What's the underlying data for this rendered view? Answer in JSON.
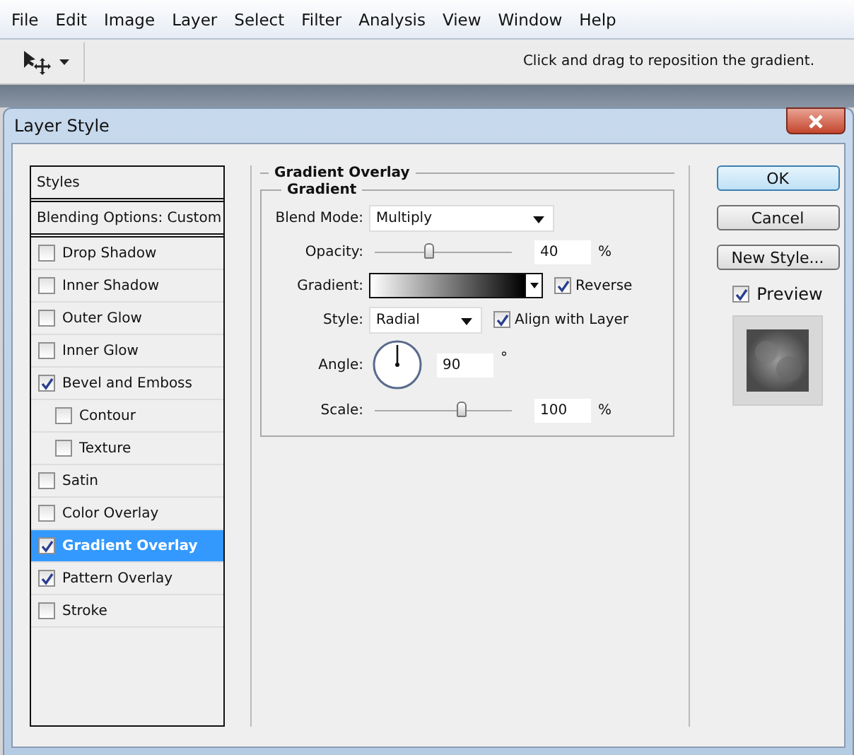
{
  "menu": [
    "File",
    "Edit",
    "Image",
    "Layer",
    "Select",
    "Filter",
    "Analysis",
    "View",
    "Window",
    "Help"
  ],
  "toolbar": {
    "hint": "Click and drag to reposition the gradient."
  },
  "dialog": {
    "title": "Layer Style",
    "styles": [
      {
        "kind": "header",
        "label": "Styles",
        "selected": false
      },
      {
        "kind": "header",
        "label": "Blending Options: Custom",
        "selected": false
      },
      {
        "kind": "check",
        "label": "Drop Shadow",
        "checked": false,
        "selected": false
      },
      {
        "kind": "check",
        "label": "Inner Shadow",
        "checked": false,
        "selected": false
      },
      {
        "kind": "check",
        "label": "Outer Glow",
        "checked": false,
        "selected": false
      },
      {
        "kind": "check",
        "label": "Inner Glow",
        "checked": false,
        "selected": false
      },
      {
        "kind": "check",
        "label": "Bevel and Emboss",
        "checked": true,
        "selected": false,
        "children": [
          {
            "kind": "check",
            "label": "Contour",
            "checked": false,
            "selected": false
          },
          {
            "kind": "check",
            "label": "Texture",
            "checked": false,
            "selected": false
          }
        ]
      },
      {
        "kind": "check",
        "label": "Satin",
        "checked": false,
        "selected": false
      },
      {
        "kind": "check",
        "label": "Color Overlay",
        "checked": false,
        "selected": false
      },
      {
        "kind": "check",
        "label": "Gradient Overlay",
        "checked": true,
        "selected": true
      },
      {
        "kind": "check",
        "label": "Pattern Overlay",
        "checked": true,
        "selected": false
      },
      {
        "kind": "check",
        "label": "Stroke",
        "checked": false,
        "selected": false
      }
    ],
    "panel": {
      "title": "Gradient Overlay",
      "group": "Gradient",
      "blend_mode": {
        "label": "Blend Mode:",
        "value": "Multiply"
      },
      "opacity": {
        "label": "Opacity:",
        "level": 0.39,
        "value": "40",
        "unit": "%"
      },
      "gradient": {
        "label": "Gradient:",
        "reverse": {
          "label": "Reverse",
          "checked": true
        }
      },
      "style": {
        "label": "Style:",
        "value": "Radial",
        "align": {
          "label": "Align with Layer",
          "checked": true
        }
      },
      "angle": {
        "label": "Angle:",
        "value": "90",
        "unit": "°"
      },
      "scale": {
        "label": "Scale:",
        "level": 0.63,
        "value": "100",
        "unit": "%"
      }
    },
    "buttons": [
      {
        "label": "OK",
        "default": true
      },
      {
        "label": "Cancel",
        "default": false
      },
      {
        "label": "New Style...",
        "default": false
      }
    ],
    "preview": {
      "label": "Preview",
      "checked": true
    }
  }
}
